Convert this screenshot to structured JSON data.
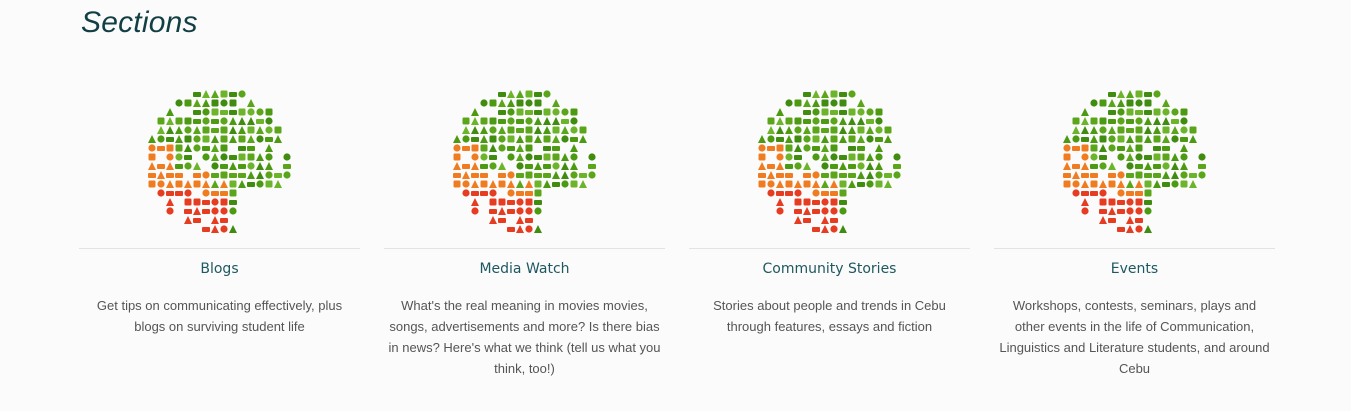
{
  "page": {
    "heading": "Sections"
  },
  "colors": {
    "heading": "#123f44",
    "card_title": "#1e5860",
    "description": "#555555",
    "icon_green": "#5aa51a",
    "icon_orange": "#f07c22",
    "icon_red": "#e53c22"
  },
  "sections": [
    {
      "title": "Blogs",
      "description": "Get tips on communicating effectively, plus blogs on surviving student life",
      "image_icon": "communication-icons-circle"
    },
    {
      "title": "Media Watch",
      "description": "What's the real meaning in movies movies, songs, advertisements and more? Is there bias in news? Here's what we think (tell us what you think, too!)",
      "image_icon": "communication-icons-circle"
    },
    {
      "title": "Community Stories",
      "description": "Stories about people and trends in Cebu through features, essays and fiction",
      "image_icon": "communication-icons-circle"
    },
    {
      "title": "Events",
      "description": "Workshops, contests, seminars, plays and other events in the life of Communication, Linguistics and Literature students, and around Cebu",
      "image_icon": "communication-icons-circle"
    }
  ]
}
